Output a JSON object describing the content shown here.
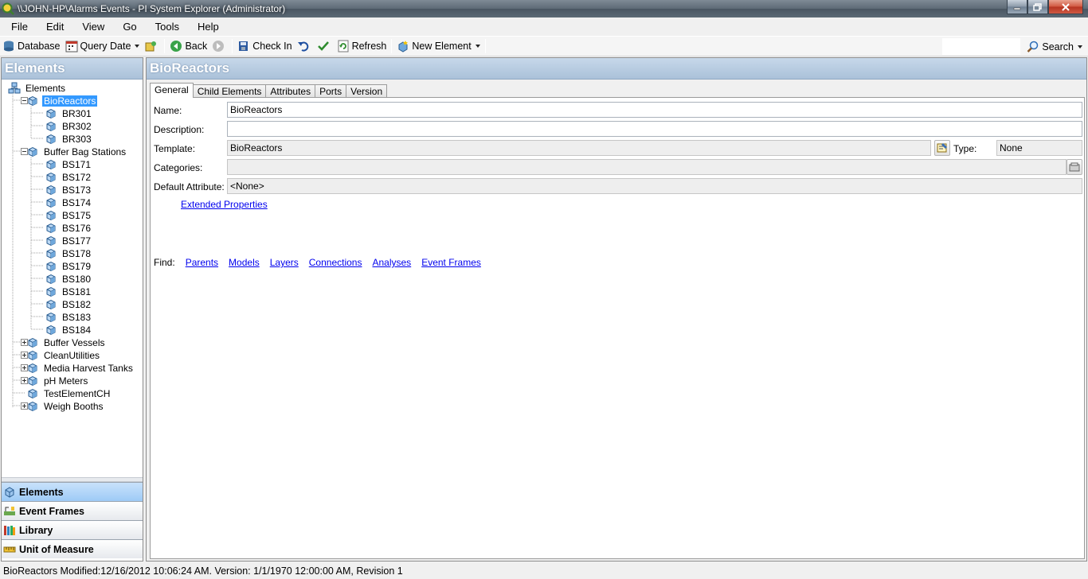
{
  "window": {
    "title": "\\\\JOHN-HP\\Alarms Events - PI System Explorer (Administrator)"
  },
  "menu": [
    "File",
    "Edit",
    "View",
    "Go",
    "Tools",
    "Help"
  ],
  "toolbar": {
    "database": "Database",
    "query_date": "Query Date",
    "back": "Back",
    "check_in": "Check In",
    "refresh": "Refresh",
    "new_element": "New Element",
    "search": "Search"
  },
  "left_panel": {
    "title": "Elements",
    "tree": {
      "root": "Elements",
      "bioreactors": {
        "label": "BioReactors",
        "children": [
          "BR301",
          "BR302",
          "BR303"
        ]
      },
      "buffer_bag_stations": {
        "label": "Buffer Bag Stations",
        "children": [
          "BS171",
          "BS172",
          "BS173",
          "BS174",
          "BS175",
          "BS176",
          "BS177",
          "BS178",
          "BS179",
          "BS180",
          "BS181",
          "BS182",
          "BS183",
          "BS184"
        ]
      },
      "others": [
        "Buffer Vessels",
        "CleanUtilities",
        "Media Harvest Tanks",
        "pH Meters",
        "TestElementCH",
        "Weigh Booths"
      ]
    },
    "nav": [
      "Elements",
      "Event Frames",
      "Library",
      "Unit of Measure"
    ]
  },
  "right_panel": {
    "title": "BioReactors",
    "tabs": [
      "General",
      "Child Elements",
      "Attributes",
      "Ports",
      "Version"
    ],
    "form": {
      "name_label": "Name:",
      "name_value": "BioReactors",
      "description_label": "Description:",
      "description_value": "",
      "template_label": "Template:",
      "template_value": "BioReactors",
      "type_label": "Type:",
      "type_value": "None",
      "categories_label": "Categories:",
      "categories_value": "",
      "default_attribute_label": "Default Attribute:",
      "default_attribute_value": "<None>",
      "extended_properties": "Extended Properties",
      "find_label": "Find:",
      "find_links": [
        "Parents",
        "Models",
        "Layers",
        "Connections",
        "Analyses",
        "Event Frames"
      ]
    }
  },
  "status": "BioReactors  Modified:12/16/2012 10:06:24 AM.  Version: 1/1/1970 12:00:00 AM, Revision 1"
}
